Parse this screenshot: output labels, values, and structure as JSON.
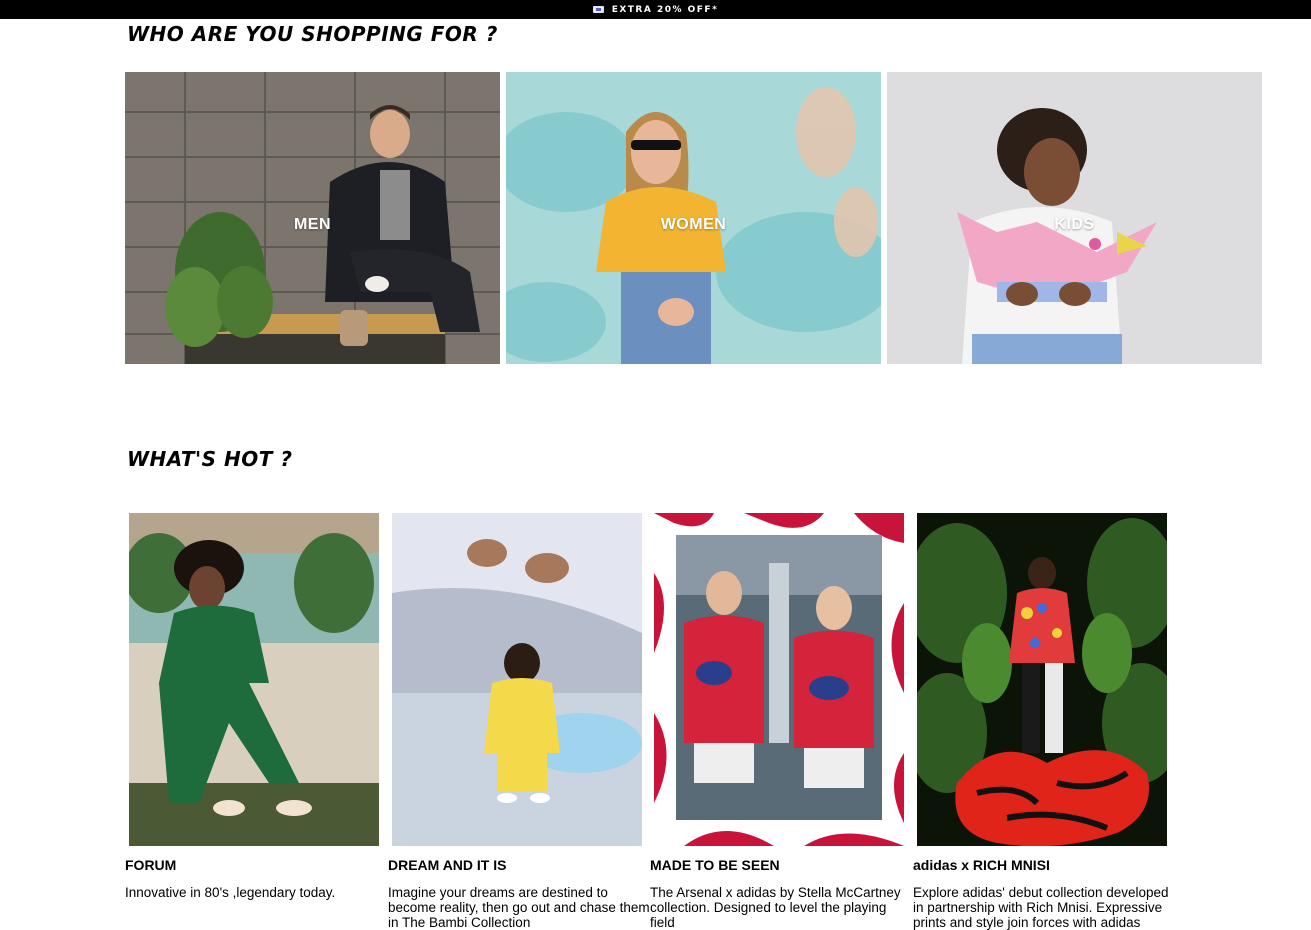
{
  "promo": {
    "text": "EXTRA 20% OFF*",
    "icon": "ticket-icon"
  },
  "shopping_for": {
    "title": "WHO ARE YOU SHOPPING FOR ?",
    "categories": [
      {
        "label": "MEN"
      },
      {
        "label": "WOMEN"
      },
      {
        "label": "KIDS"
      }
    ]
  },
  "whats_hot": {
    "title": "WHAT'S HOT ?",
    "cards": [
      {
        "title": "FORUM",
        "description": "Innovative in 80's ,legendary today."
      },
      {
        "title": "DREAM AND IT IS",
        "description": "Imagine your dreams are destined to become reality, then go out and chase them in The Bambi Collection"
      },
      {
        "title": "MADE TO BE SEEN",
        "description": "The Arsenal x adidas by Stella McCartney collection. Designed to level the playing field"
      },
      {
        "title": "adidas x RICH MNISI",
        "description": "Explore adidas' debut collection developed in partnership with Rich Mnisi. Expressive prints and style join forces with adidas"
      }
    ]
  },
  "colors": {
    "promo_bg": "#000000",
    "text": "#000000",
    "background": "#ffffff"
  }
}
